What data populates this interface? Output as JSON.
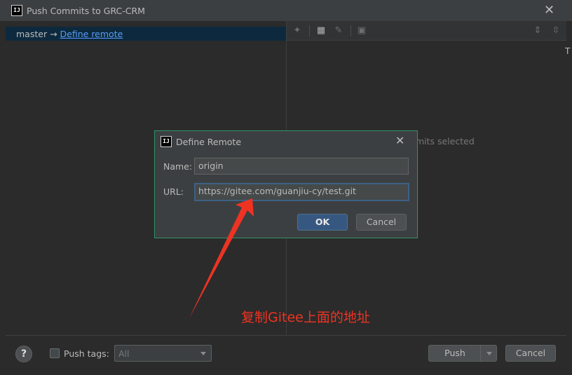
{
  "window": {
    "title": "Push Commits to GRC-CRM",
    "app_icon_text": "IJ"
  },
  "branch": {
    "source": "master",
    "arrow": "→",
    "target_link": "Define remote"
  },
  "details": {
    "empty_text": "mits selected"
  },
  "dialog": {
    "title": "Define Remote",
    "app_icon_text": "IJ",
    "name_label": "Name:",
    "name_value": "origin",
    "url_label": "URL:",
    "url_value": "https://gitee.com/guanjiu-cy/test.git",
    "ok_label": "OK",
    "cancel_label": "Cancel"
  },
  "footer": {
    "help_label": "?",
    "push_tags_label": "Push tags:",
    "push_tags_checked": false,
    "tags_value": "All",
    "push_label": "Push",
    "cancel_label": "Cancel"
  },
  "annotation": {
    "text": "复制Gitee上面的地址",
    "color": "#ee3322"
  },
  "edge": {
    "glyph": "T"
  },
  "colors": {
    "selection": "#0d293e",
    "link": "#589df6",
    "dialog_border": "#2e9466",
    "primary_button": "#365880"
  }
}
